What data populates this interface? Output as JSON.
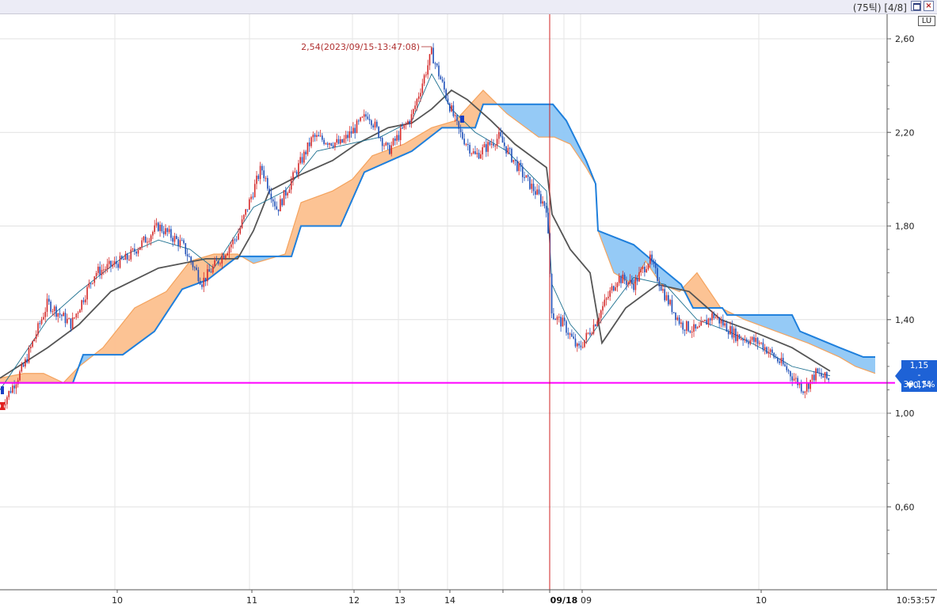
{
  "window": {
    "label": "(75틱) [4/8]",
    "corner_button": "LU"
  },
  "price_tag": {
    "price": "1,15",
    "change_pct": "- 39,15%",
    "change_abs": "▼0,74"
  },
  "colors": {
    "candle_up": "#d42a2a",
    "candle_down": "#1f4fb8",
    "cloud_orange": "#fcc08e",
    "cloud_blue": "#8fc7f5",
    "span_b_line": "#1e7fdc",
    "span_a_line": "#f4a35e",
    "base_line": "#555555",
    "conversion_line": "#1b6f8f",
    "support_line": "#ff00ff",
    "session_marker": "#d02020"
  },
  "chart_data": {
    "type": "candlestick",
    "title": "",
    "y_axis": {
      "ticks": [
        "2,60",
        "2,20",
        "1,80",
        "1,40",
        "1,00",
        "0,60"
      ],
      "tick_values": [
        2.6,
        2.2,
        1.8,
        1.4,
        1.0,
        0.6
      ],
      "range": [
        0.3,
        2.72
      ]
    },
    "x_axis": {
      "labels": [
        "10",
        "11",
        "12",
        "13",
        "14",
        "09/18",
        "09",
        "10"
      ],
      "time": "10:53:57"
    },
    "high_annotation": {
      "text": "2,54(2023/09/15-13:47:08)",
      "value": 2.54
    },
    "session_break_label": "09/18",
    "horizontal_line_value": 1.13,
    "last_price": 1.15,
    "price_path": [
      [
        0,
        1.02
      ],
      [
        30,
        1.2
      ],
      [
        60,
        1.47
      ],
      [
        90,
        1.38
      ],
      [
        120,
        1.6
      ],
      [
        160,
        1.66
      ],
      [
        200,
        1.8
      ],
      [
        230,
        1.72
      ],
      [
        255,
        1.56
      ],
      [
        300,
        1.76
      ],
      [
        330,
        2.05
      ],
      [
        350,
        1.87
      ],
      [
        395,
        2.18
      ],
      [
        430,
        2.15
      ],
      [
        465,
        2.28
      ],
      [
        490,
        2.12
      ],
      [
        520,
        2.27
      ],
      [
        545,
        2.54
      ],
      [
        565,
        2.34
      ],
      [
        580,
        2.2
      ],
      [
        600,
        2.1
      ],
      [
        630,
        2.18
      ],
      [
        660,
        2.02
      ],
      [
        690,
        1.88
      ],
      [
        697,
        1.42
      ],
      [
        712,
        1.38
      ],
      [
        730,
        1.27
      ],
      [
        750,
        1.38
      ],
      [
        780,
        1.58
      ],
      [
        800,
        1.55
      ],
      [
        820,
        1.66
      ],
      [
        840,
        1.5
      ],
      [
        860,
        1.38
      ],
      [
        880,
        1.35
      ],
      [
        900,
        1.42
      ],
      [
        930,
        1.33
      ],
      [
        960,
        1.3
      ],
      [
        990,
        1.2
      ],
      [
        1015,
        1.1
      ],
      [
        1030,
        1.17
      ],
      [
        1048,
        1.14
      ]
    ],
    "conversion_line": [
      [
        0,
        1.1
      ],
      [
        60,
        1.4
      ],
      [
        100,
        1.52
      ],
      [
        160,
        1.68
      ],
      [
        200,
        1.74
      ],
      [
        240,
        1.7
      ],
      [
        270,
        1.62
      ],
      [
        320,
        1.88
      ],
      [
        360,
        1.95
      ],
      [
        400,
        2.12
      ],
      [
        440,
        2.15
      ],
      [
        480,
        2.18
      ],
      [
        520,
        2.25
      ],
      [
        545,
        2.45
      ],
      [
        570,
        2.3
      ],
      [
        600,
        2.2
      ],
      [
        640,
        2.12
      ],
      [
        690,
        1.95
      ],
      [
        697,
        1.55
      ],
      [
        720,
        1.38
      ],
      [
        740,
        1.3
      ],
      [
        760,
        1.4
      ],
      [
        800,
        1.58
      ],
      [
        840,
        1.55
      ],
      [
        880,
        1.4
      ],
      [
        920,
        1.35
      ],
      [
        960,
        1.28
      ],
      [
        1000,
        1.2
      ],
      [
        1048,
        1.16
      ]
    ],
    "base_line": [
      [
        0,
        1.15
      ],
      [
        60,
        1.28
      ],
      [
        100,
        1.38
      ],
      [
        140,
        1.52
      ],
      [
        200,
        1.62
      ],
      [
        260,
        1.66
      ],
      [
        300,
        1.66
      ],
      [
        320,
        1.78
      ],
      [
        340,
        1.95
      ],
      [
        380,
        2.02
      ],
      [
        420,
        2.08
      ],
      [
        450,
        2.15
      ],
      [
        490,
        2.22
      ],
      [
        520,
        2.24
      ],
      [
        545,
        2.3
      ],
      [
        570,
        2.38
      ],
      [
        590,
        2.34
      ],
      [
        620,
        2.25
      ],
      [
        650,
        2.15
      ],
      [
        690,
        2.05
      ],
      [
        697,
        1.85
      ],
      [
        720,
        1.7
      ],
      [
        745,
        1.6
      ],
      [
        760,
        1.3
      ],
      [
        790,
        1.45
      ],
      [
        830,
        1.55
      ],
      [
        870,
        1.52
      ],
      [
        910,
        1.4
      ],
      [
        950,
        1.35
      ],
      [
        1000,
        1.28
      ],
      [
        1048,
        1.18
      ]
    ],
    "leading_span_a": [
      [
        0,
        1.15
      ],
      [
        30,
        1.17
      ],
      [
        55,
        1.17
      ],
      [
        80,
        1.13
      ],
      [
        100,
        1.2
      ],
      [
        130,
        1.28
      ],
      [
        170,
        1.45
      ],
      [
        210,
        1.52
      ],
      [
        240,
        1.65
      ],
      [
        270,
        1.68
      ],
      [
        300,
        1.68
      ],
      [
        320,
        1.64
      ],
      [
        360,
        1.68
      ],
      [
        380,
        1.9
      ],
      [
        420,
        1.95
      ],
      [
        445,
        2.0
      ],
      [
        470,
        2.1
      ],
      [
        510,
        2.15
      ],
      [
        545,
        2.22
      ],
      [
        575,
        2.25
      ],
      [
        610,
        2.38
      ],
      [
        640,
        2.28
      ],
      [
        680,
        2.18
      ],
      [
        700,
        2.18
      ],
      [
        720,
        2.15
      ],
      [
        740,
        2.05
      ],
      [
        752,
        1.98
      ],
      [
        755,
        1.78
      ],
      [
        775,
        1.6
      ],
      [
        800,
        1.55
      ],
      [
        815,
        1.65
      ],
      [
        835,
        1.55
      ],
      [
        858,
        1.52
      ],
      [
        880,
        1.6
      ],
      [
        910,
        1.45
      ],
      [
        940,
        1.4
      ],
      [
        980,
        1.35
      ],
      [
        1020,
        1.3
      ],
      [
        1060,
        1.24
      ],
      [
        1080,
        1.2
      ],
      [
        1105,
        1.17
      ]
    ],
    "leading_span_b": [
      [
        0,
        1.13
      ],
      [
        92,
        1.13
      ],
      [
        105,
        1.25
      ],
      [
        155,
        1.25
      ],
      [
        195,
        1.35
      ],
      [
        230,
        1.53
      ],
      [
        262,
        1.57
      ],
      [
        300,
        1.67
      ],
      [
        368,
        1.67
      ],
      [
        380,
        1.8
      ],
      [
        430,
        1.8
      ],
      [
        460,
        2.03
      ],
      [
        520,
        2.12
      ],
      [
        558,
        2.22
      ],
      [
        600,
        2.22
      ],
      [
        610,
        2.32
      ],
      [
        698,
        2.32
      ],
      [
        715,
        2.25
      ],
      [
        740,
        2.08
      ],
      [
        752,
        1.98
      ],
      [
        755,
        1.78
      ],
      [
        800,
        1.72
      ],
      [
        835,
        1.62
      ],
      [
        860,
        1.55
      ],
      [
        875,
        1.45
      ],
      [
        912,
        1.45
      ],
      [
        918,
        1.42
      ],
      [
        1000,
        1.42
      ],
      [
        1010,
        1.35
      ],
      [
        1060,
        1.28
      ],
      [
        1090,
        1.24
      ],
      [
        1105,
        1.24
      ]
    ]
  }
}
